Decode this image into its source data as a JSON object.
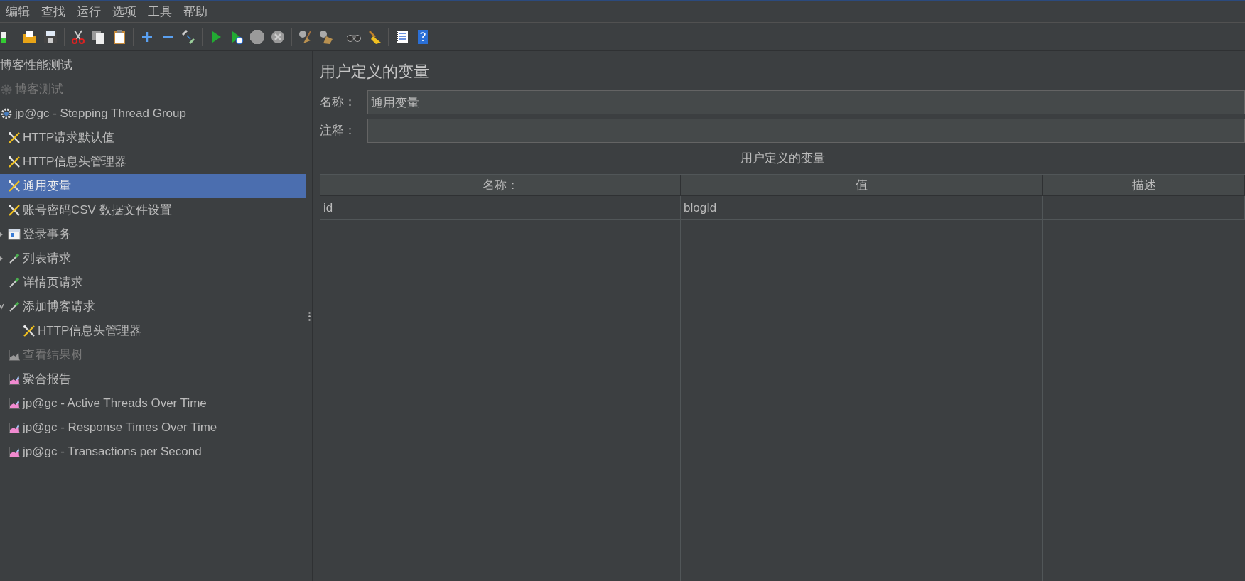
{
  "menu": [
    "编辑",
    "查找",
    "运行",
    "选项",
    "工具",
    "帮助"
  ],
  "tree": [
    {
      "label": "博客性能测试",
      "selected": false,
      "disabled": false,
      "children": [
        {
          "label": "博客测试",
          "kind": "thread-group",
          "selected": false,
          "disabled": true
        },
        {
          "label": "jp@gc - Stepping Thread Group",
          "kind": "thread-group",
          "selected": false,
          "disabled": false,
          "children": [
            {
              "label": "HTTP请求默认值",
              "kind": "config",
              "selected": false,
              "disabled": false
            },
            {
              "label": "HTTP信息头管理器",
              "kind": "config",
              "selected": false,
              "disabled": false
            },
            {
              "label": "通用变量",
              "kind": "config",
              "selected": true,
              "disabled": false
            },
            {
              "label": "账号密码CSV 数据文件设置",
              "kind": "config",
              "selected": false,
              "disabled": false
            },
            {
              "label": "登录事务",
              "kind": "controller",
              "selected": false,
              "disabled": false,
              "expanded": false
            },
            {
              "label": "列表请求",
              "kind": "sampler",
              "selected": false,
              "disabled": false,
              "expanded": false
            },
            {
              "label": "详情页请求",
              "kind": "sampler",
              "selected": false,
              "disabled": false
            },
            {
              "label": "添加博客请求",
              "kind": "sampler",
              "selected": false,
              "disabled": false,
              "expanded": true,
              "children": [
                {
                  "label": "HTTP信息头管理器",
                  "kind": "config",
                  "selected": false,
                  "disabled": false
                }
              ]
            },
            {
              "label": "查看结果树",
              "kind": "listener",
              "selected": false,
              "disabled": true
            },
            {
              "label": "聚合报告",
              "kind": "listener",
              "selected": false,
              "disabled": false
            },
            {
              "label": "jp@gc - Active Threads Over Time",
              "kind": "listener",
              "selected": false,
              "disabled": false
            },
            {
              "label": "jp@gc - Response Times Over Time",
              "kind": "listener",
              "selected": false,
              "disabled": false
            },
            {
              "label": "jp@gc - Transactions per Second",
              "kind": "listener",
              "selected": false,
              "disabled": false
            }
          ]
        }
      ]
    }
  ],
  "editor": {
    "title": "用户定义的变量",
    "name_label": "名称：",
    "name_value": "通用变量",
    "comment_label": "注释：",
    "table": {
      "title": "用户定义的变量",
      "columns": [
        "名称：",
        "值",
        "描述"
      ],
      "rows": [
        {
          "name": "id",
          "value": "blogId"
        }
      ]
    }
  }
}
